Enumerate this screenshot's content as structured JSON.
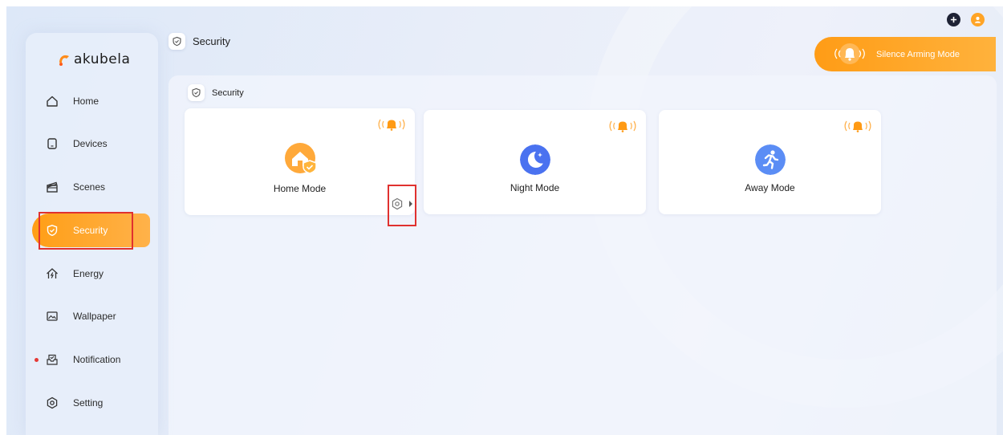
{
  "app": {
    "brand": "akubela",
    "accent": "#ffa426",
    "highlight_outline": "#e0312f"
  },
  "header": {
    "page_title": "Security"
  },
  "top_icons": [
    {
      "name": "add-icon",
      "color": "#1e2235"
    },
    {
      "name": "user-icon",
      "color": "#ffa426"
    }
  ],
  "silence_button": {
    "label": "Silence Arming Mode",
    "icon": "bell-icon"
  },
  "sidebar": {
    "items": [
      {
        "label": "Home",
        "icon": "home-icon"
      },
      {
        "label": "Devices",
        "icon": "device-icon"
      },
      {
        "label": "Scenes",
        "icon": "clapperboard-icon"
      },
      {
        "label": "Security",
        "icon": "shield-icon",
        "active": true
      },
      {
        "label": "Energy",
        "icon": "energy-icon"
      },
      {
        "label": "Wallpaper",
        "icon": "image-icon"
      },
      {
        "label": "Notification",
        "icon": "inbox-icon",
        "has_unread": true
      },
      {
        "label": "Setting",
        "icon": "gear-icon"
      }
    ]
  },
  "main": {
    "section_title": "Security",
    "modes": [
      {
        "label": "Home Mode",
        "icon": "home-shield-icon",
        "color": "#ffa93a",
        "alarm_icon": "alarm-bell-icon",
        "settings_icon": "gear-icon"
      },
      {
        "label": "Night Mode",
        "icon": "moon-icon",
        "color": "#4a72f0",
        "alarm_icon": "alarm-bell-icon"
      },
      {
        "label": "Away Mode",
        "icon": "running-icon",
        "color": "#5b8df5",
        "alarm_icon": "alarm-bell-icon"
      }
    ]
  }
}
